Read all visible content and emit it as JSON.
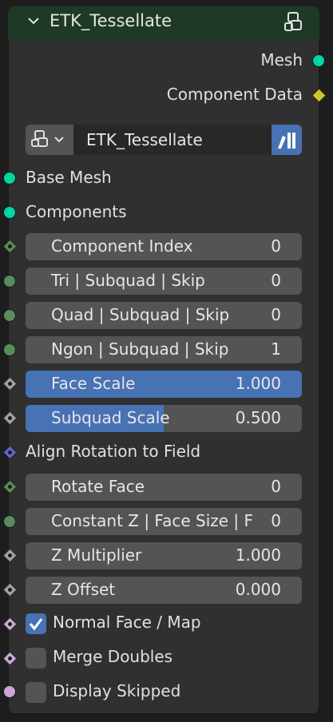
{
  "node": {
    "title": "ETK_Tessellate",
    "header_color": "#1e3a26"
  },
  "outputs": [
    {
      "label": "Mesh",
      "socket_color": "#00d6a3",
      "socket_shape": "circle"
    },
    {
      "label": "Component Data",
      "socket_color": "#ccc62a",
      "socket_shape": "diamond"
    }
  ],
  "group_selector": {
    "name": "ETK_Tessellate"
  },
  "inputs": {
    "base_mesh": {
      "label": "Base Mesh",
      "socket_color": "#00d6a3"
    },
    "components": {
      "label": "Components",
      "socket_color": "#00d6a3"
    },
    "component_index": {
      "label": "Component Index",
      "value": "0",
      "socket_color": "#598c5c"
    },
    "tri": {
      "label": "Tri | Subquad | Skip",
      "value": "0",
      "socket_color": "#598c5c"
    },
    "quad": {
      "label": "Quad | Subquad | Skip",
      "value": "0",
      "socket_color": "#598c5c"
    },
    "ngon": {
      "label": "Ngon | Subquad | Skip",
      "value": "1",
      "socket_color": "#598c5c"
    },
    "face_scale": {
      "label": "Face Scale",
      "value": "1.000",
      "fill": 1.0,
      "socket_color": "#a1a1a1"
    },
    "subquad_scale": {
      "label": "Subquad Scale",
      "value": "0.500",
      "fill": 0.5,
      "socket_color": "#a1a1a1"
    },
    "align_rotation": {
      "label": "Align Rotation to Field",
      "socket_color": "#6363c7"
    },
    "rotate_face": {
      "label": "Rotate Face",
      "value": "0",
      "socket_color": "#598c5c"
    },
    "constant_z": {
      "label": "Constant Z | Face Size | F",
      "value": "0",
      "socket_color": "#598c5c"
    },
    "z_multiplier": {
      "label": "Z Multiplier",
      "value": "1.000",
      "socket_color": "#a1a1a1"
    },
    "z_offset": {
      "label": "Z Offset",
      "value": "0.000",
      "socket_color": "#a1a1a1"
    },
    "normal_face_map": {
      "label": "Normal Face / Map",
      "checked": true,
      "socket_color": "#cca6d6"
    },
    "merge_doubles": {
      "label": "Merge Doubles",
      "checked": false,
      "socket_color": "#cca6d6"
    },
    "display_skipped": {
      "label": "Display Skipped",
      "checked": false,
      "socket_color": "#cca6d6"
    }
  },
  "colors": {
    "accent": "#4772b3",
    "field": "#545454",
    "node_body": "#303030"
  }
}
